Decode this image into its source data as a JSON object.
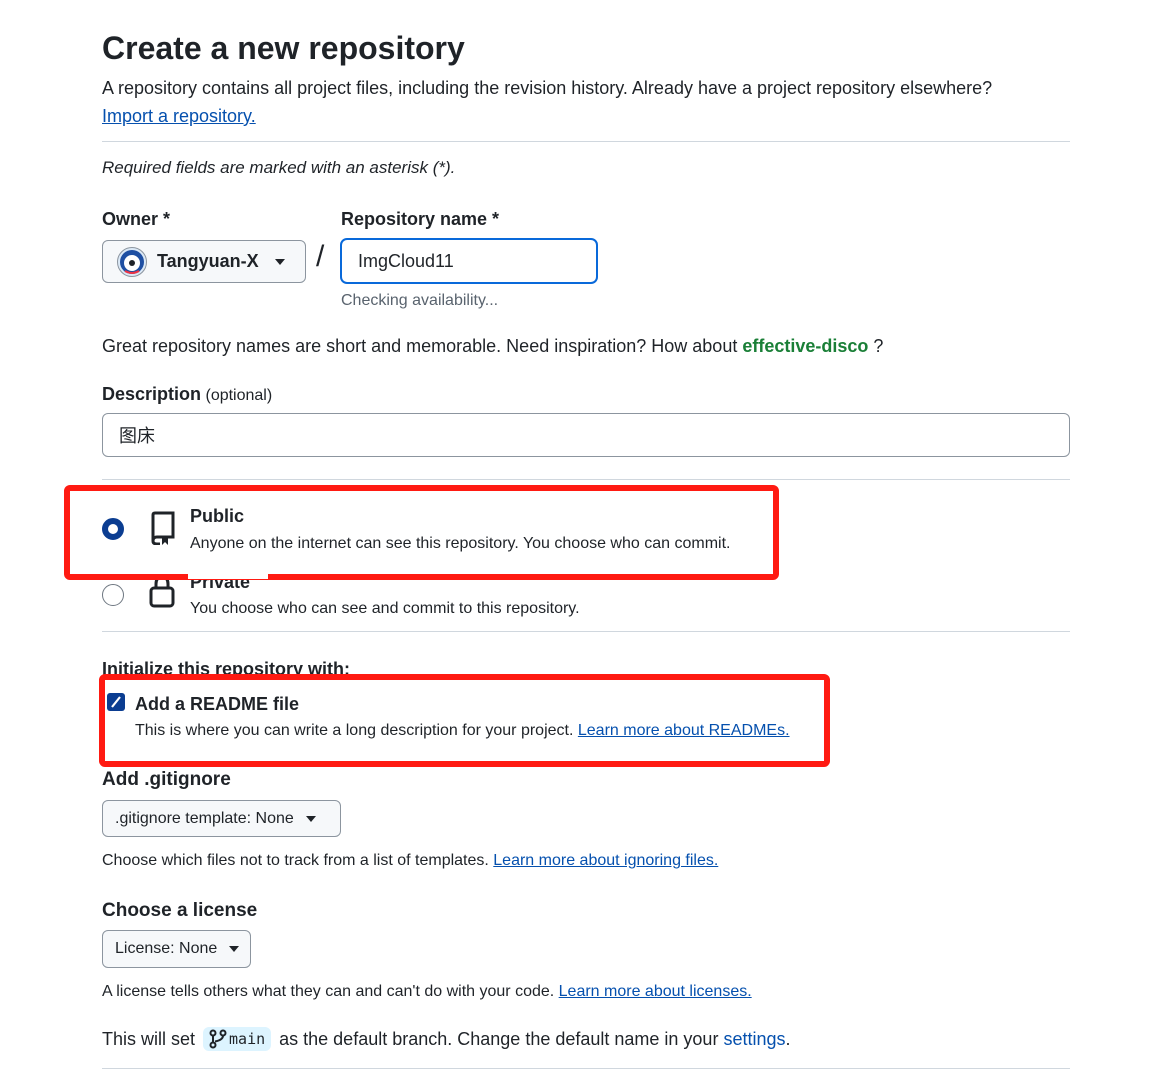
{
  "page": {
    "title": "Create a new repository",
    "intro": "A repository contains all project files, including the revision history. Already have a project repository elsewhere?",
    "import_link": "Import a repository.",
    "required_note": "Required fields are marked with an asterisk (*)."
  },
  "owner": {
    "label": "Owner *",
    "value": "Tangyuan-X"
  },
  "repo": {
    "slash": "/",
    "label": "Repository name *",
    "value": "ImgCloud11",
    "status": "Checking availability..."
  },
  "suggestion": {
    "text": "Great repository names are short and memorable. Need inspiration? How about",
    "name": "effective-disco",
    "after": "?"
  },
  "description": {
    "label": "Description",
    "optional": "(optional)",
    "value": "图床"
  },
  "visibility": {
    "public_title": "Public",
    "public_desc": "Anyone on the internet can see this repository. You choose who can commit.",
    "private_title": "Private",
    "private_desc": "You choose who can see and commit to this repository.",
    "selected": "public"
  },
  "init": {
    "heading": "Initialize this repository with:",
    "readme_title": "Add a README file",
    "readme_desc": "This is where you can write a long description for your project.",
    "readme_link": "Learn more about READMEs.",
    "readme_checked": true
  },
  "gitignore": {
    "heading": "Add .gitignore",
    "button": ".gitignore template: None",
    "desc": "Choose which files not to track from a list of templates.",
    "link": "Learn more about ignoring files."
  },
  "license": {
    "heading": "Choose a license",
    "button": "License: None",
    "desc": "A license tells others what they can and can't do with your code.",
    "link": "Learn more about licenses."
  },
  "branch": {
    "prefix": "This will set",
    "name": "main",
    "middle": "as the default branch. Change the default name in your",
    "settings_link": "settings",
    "suffix": "."
  },
  "colors": {
    "accent": "#0550ae",
    "success": "#1a7f37",
    "highlight": "#ff1a12",
    "border": "#d0d7de"
  }
}
